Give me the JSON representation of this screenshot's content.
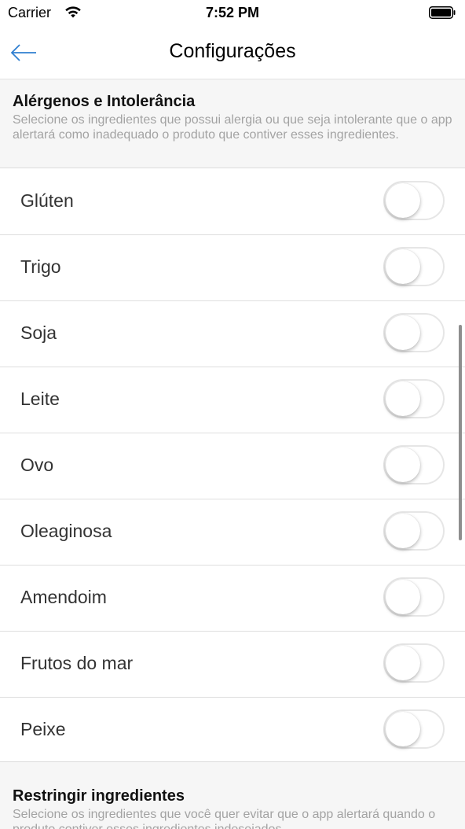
{
  "status_bar": {
    "carrier": "Carrier",
    "time": "7:52 PM",
    "wifi_icon": "wifi-icon",
    "battery_icon": "battery-icon"
  },
  "nav": {
    "title": "Configurações",
    "back_icon": "arrow-left-icon",
    "accent_color": "#2f7fd0"
  },
  "section_allergens": {
    "title": "Alérgenos e Intolerância",
    "description": "Selecione os ingredientes que possui alergia ou que seja intolerante que o app alertará como inadequado o produto que contiver esses ingredientes."
  },
  "allergens": [
    {
      "label": "Glúten",
      "enabled": false
    },
    {
      "label": "Trigo",
      "enabled": false
    },
    {
      "label": "Soja",
      "enabled": false
    },
    {
      "label": "Leite",
      "enabled": false
    },
    {
      "label": "Ovo",
      "enabled": false
    },
    {
      "label": "Oleaginosa",
      "enabled": false
    },
    {
      "label": "Amendoim",
      "enabled": false
    },
    {
      "label": "Frutos do mar",
      "enabled": false
    },
    {
      "label": "Peixe",
      "enabled": false
    }
  ],
  "section_restrict": {
    "title": "Restringir ingredientes",
    "description": "Selecione os ingredientes que você quer evitar que o app alertará quando o produto contiver esses ingredientes indesejados."
  }
}
